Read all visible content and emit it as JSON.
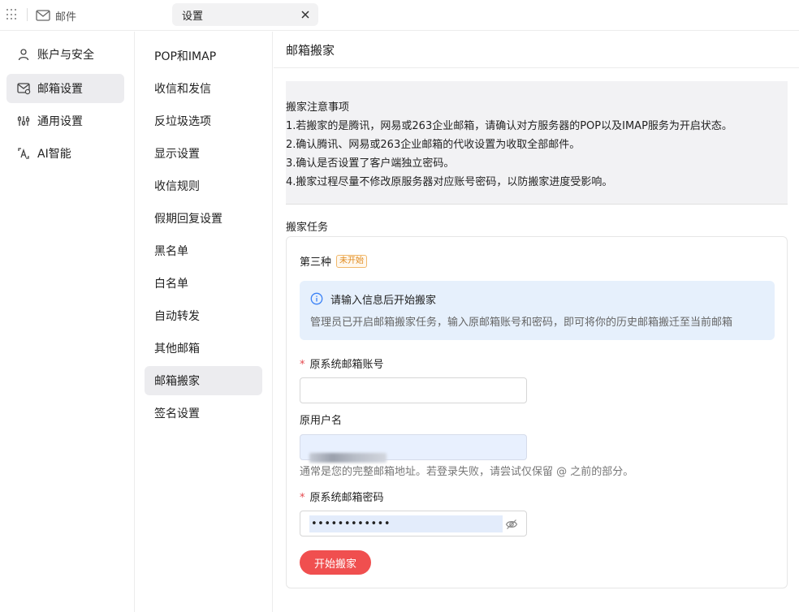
{
  "topbar": {
    "app_label": "邮件",
    "active_tab_label": "设置"
  },
  "leftnav": {
    "items": [
      {
        "label": "账户与安全",
        "icon": "user-icon"
      },
      {
        "label": "邮箱设置",
        "icon": "mailbox-settings-icon"
      },
      {
        "label": "通用设置",
        "icon": "sliders-icon"
      },
      {
        "label": "AI智能",
        "icon": "ai-icon"
      }
    ],
    "active_index": 1
  },
  "midnav": {
    "items": [
      {
        "label": "POP和IMAP"
      },
      {
        "label": "收信和发信"
      },
      {
        "label": "反垃圾选项"
      },
      {
        "label": "显示设置"
      },
      {
        "label": "收信规则"
      },
      {
        "label": "假期回复设置"
      },
      {
        "label": "黑名单"
      },
      {
        "label": "白名单"
      },
      {
        "label": "自动转发"
      },
      {
        "label": "其他邮箱"
      },
      {
        "label": "邮箱搬家"
      },
      {
        "label": "签名设置"
      }
    ],
    "active_index": 10
  },
  "main": {
    "title": "邮箱搬家",
    "notice": {
      "title": "搬家注意事项",
      "lines": [
        "1.若搬家的是腾讯，网易或263企业邮箱，请确认对方服务器的POP以及IMAP服务为开启状态。",
        "2.确认腾讯、网易或263企业邮箱的代收设置为收取全部邮件。",
        "3.确认是否设置了客户端独立密码。",
        "4.搬家过程尽量不修改原服务器对应账号密码，以防搬家进度受影响。"
      ]
    },
    "task_section_title": "搬家任务",
    "task": {
      "name": "第三种",
      "status": "未开始",
      "info_title": "请输入信息后开始搬家",
      "info_desc": "管理员已开启邮箱搬家任务，输入原邮箱账号和密码，即可将你的历史邮箱搬迁至当前邮箱",
      "account_label": "原系统邮箱账号",
      "account_value": "",
      "username_label": "原用户名",
      "username_help": "通常是您的完整邮箱地址。若登录失败，请尝试仅保留 @ 之前的部分。",
      "password_label": "原系统邮箱密码",
      "password_mask": "••••••••••••",
      "start_button": "开始搬家"
    }
  },
  "colors": {
    "accent_red": "#f04f4f",
    "info_bg": "#e6f0fc",
    "info_icon": "#3b82f6",
    "status_orange": "#e08a1e",
    "required_star": "#e5484d"
  }
}
